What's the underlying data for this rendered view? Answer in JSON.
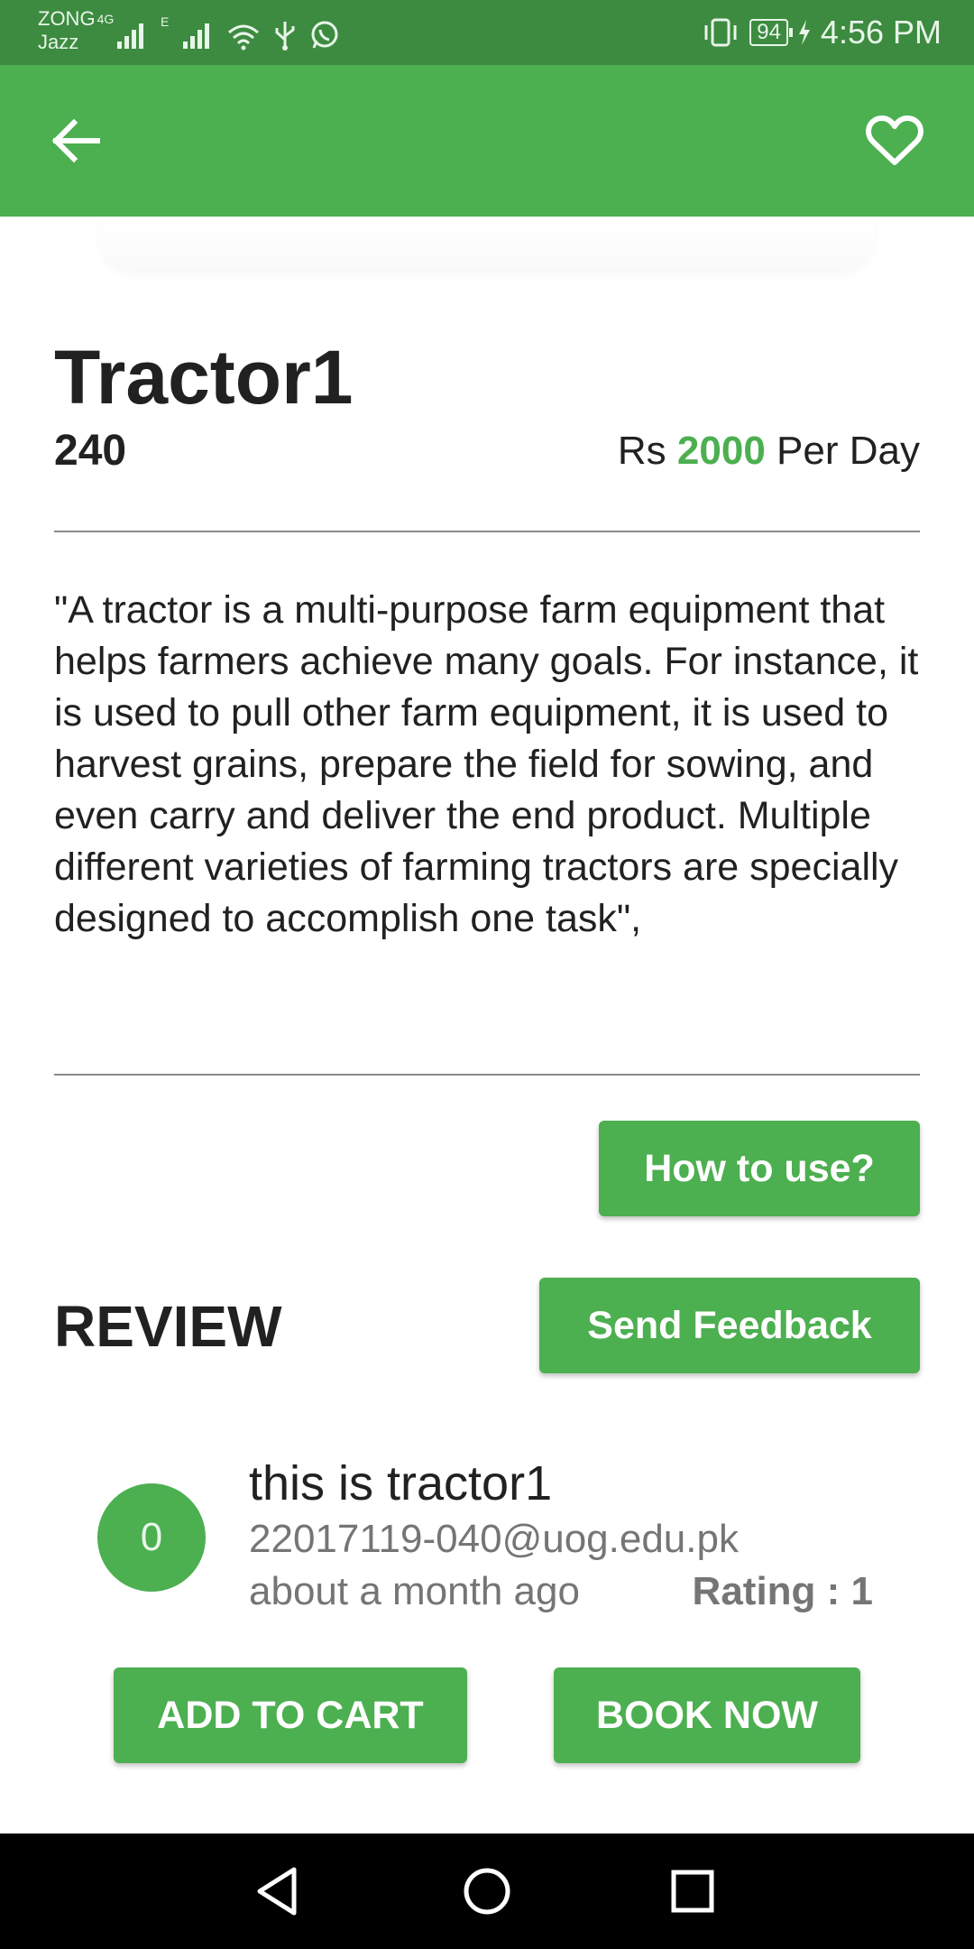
{
  "status_bar": {
    "carrier_primary": "ZONG",
    "carrier_network": "4G",
    "carrier_secondary": "Jazz",
    "network_secondary": "E",
    "battery": "94",
    "time": "4:56 PM",
    "icons": [
      "signal-icon",
      "wifi-icon",
      "usb-icon",
      "whatsapp-icon",
      "vibrate-icon",
      "battery-icon",
      "charging-icon"
    ]
  },
  "app_bar": {
    "back_icon": "back-arrow-icon",
    "favorite_icon": "heart-outline-icon",
    "color": "#4caf50"
  },
  "product": {
    "title": "Tractor1",
    "id": "240",
    "price_prefix": "Rs",
    "price_amount": "2000",
    "price_suffix": "Per Day",
    "description": "\"A tractor is a multi-purpose farm equipment that helps farmers achieve many goals. For instance, it is used to pull other farm equipment, it is used to harvest grains, prepare the field for sowing, and even carry and deliver the end product. Multiple different varieties of farming tractors are specially designed to accomplish one task\","
  },
  "actions": {
    "how_to_use": "How to use?",
    "send_feedback": "Send Feedback",
    "add_to_cart": "ADD TO CART",
    "book_now": "BOOK NOW"
  },
  "review": {
    "heading": "REVIEW",
    "items": [
      {
        "avatar": "0",
        "text": "this is tractor1",
        "email": "22017119-040@uog.edu.pk",
        "time": "about a month ago",
        "rating": "Rating : 1"
      }
    ]
  },
  "nav_bar": {
    "icons": [
      "nav-back-icon",
      "nav-home-icon",
      "nav-recent-icon"
    ]
  }
}
